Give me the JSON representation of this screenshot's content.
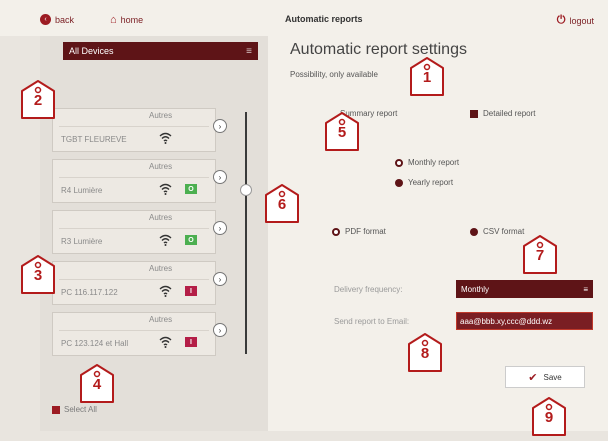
{
  "topbar": {
    "back_label": "back",
    "home_label": "home",
    "title": "Automatic reports",
    "logout_label": "logout"
  },
  "left": {
    "device_selector": "All Devices",
    "devices": [
      {
        "category": "Autres",
        "name": "TGBT FLEUREVE",
        "switch": ""
      },
      {
        "category": "Autres",
        "name": "R4 Lumière",
        "switch": "O"
      },
      {
        "category": "Autres",
        "name": "R3 Lumière",
        "switch": "O"
      },
      {
        "category": "Autres",
        "name": "PC 116.117.122",
        "switch": "I"
      },
      {
        "category": "Autres",
        "name": "PC 123.124 et Hall",
        "switch": "I"
      }
    ],
    "select_all_label": "Select All"
  },
  "main": {
    "title": "Automatic report settings",
    "subtitle": "Possibility, only available",
    "summary_report_label": "Summary report",
    "detailed_report_label": "Detailed report",
    "monthly_report_label": "Monthly report",
    "yearly_report_label": "Yearly report",
    "pdf_format_label": "PDF format",
    "csv_format_label": "CSV format",
    "delivery_frequency_label": "Delivery frequency:",
    "delivery_frequency_value": "Monthly",
    "email_label": "Send report to Email:",
    "email_value": "aaa@bbb.xy,ccc@ddd.wz",
    "save_label": "Save"
  },
  "callouts": [
    "1",
    "2",
    "3",
    "4",
    "5",
    "6",
    "7",
    "8",
    "9"
  ],
  "colors": {
    "accent": "#5e1417",
    "brand": "#9c1b22",
    "switch_on": "#4caf50",
    "switch_off": "#b41e47",
    "callout": "#b31b1b"
  }
}
